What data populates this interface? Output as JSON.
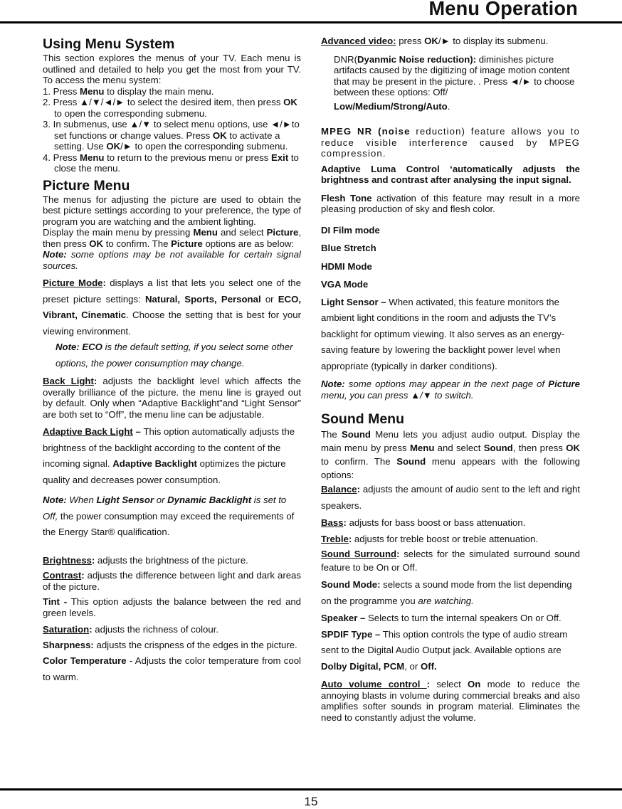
{
  "header": {
    "title": "Menu Operation"
  },
  "footer": {
    "page_number": "15"
  },
  "left_column": [
    {
      "type": "heading",
      "name": "using-menu-system-heading",
      "text": "Using Menu System"
    },
    {
      "type": "para",
      "name": "using-menu-intro",
      "cls": "",
      "runs": [
        {
          "t": "This section explores the menus of your TV. Each menu is outlined and detailed to help you get the most from your TV.  To access the menu system:"
        }
      ]
    },
    {
      "type": "para",
      "name": "step-1",
      "cls": "left",
      "runs": [
        {
          "t": "1. Press "
        },
        {
          "t": "Menu",
          "s": "b"
        },
        {
          "t": " to display the main menu."
        }
      ]
    },
    {
      "type": "para",
      "name": "step-2",
      "cls": "left ind2",
      "runs": [
        {
          "t": "2. Press ▲/▼/◄/► to select the desired item, then press "
        },
        {
          "t": "OK",
          "s": "b"
        },
        {
          "t": " to open the corresponding submenu."
        }
      ]
    },
    {
      "type": "para",
      "name": "step-3",
      "cls": "left ind2",
      "runs": [
        {
          "t": "3. In submenus, use ▲/▼ to select menu options, use ◄/►to set functions or change values. Press "
        },
        {
          "t": "OK",
          "s": "b"
        },
        {
          "t": " to activate a setting. Use "
        },
        {
          "t": "OK",
          "s": "b"
        },
        {
          "t": "/► to open the corresponding submenu."
        }
      ]
    },
    {
      "type": "para",
      "name": "step-4",
      "cls": "left ind2",
      "runs": [
        {
          "t": "4. Press "
        },
        {
          "t": "Menu",
          "s": "b"
        },
        {
          "t": " to return to the previous menu or press "
        },
        {
          "t": "Exit",
          "s": "b"
        },
        {
          "t": " to close the menu."
        }
      ]
    },
    {
      "type": "heading",
      "name": "picture-menu-heading",
      "cls": "gap4",
      "text": "Picture Menu"
    },
    {
      "type": "para",
      "name": "picture-menu-intro",
      "cls": "",
      "runs": [
        {
          "t": "The menus for adjusting the picture are used to obtain the best picture settings according to your preference, the type of program you are watching and the ambient lighting."
        }
      ]
    },
    {
      "type": "para",
      "name": "picture-menu-display",
      "cls": "",
      "runs": [
        {
          "t": "Display the main menu by pressing "
        },
        {
          "t": "Menu",
          "s": "b"
        },
        {
          "t": " and select "
        },
        {
          "t": "Picture",
          "s": "b"
        },
        {
          "t": ", then press "
        },
        {
          "t": "OK",
          "s": "b"
        },
        {
          "t": " to confirm. The "
        },
        {
          "t": "Picture",
          "s": "b"
        },
        {
          "t": " options are as below:"
        }
      ]
    },
    {
      "type": "para",
      "name": "picture-menu-note",
      "cls": "",
      "runs": [
        {
          "t": "Note:",
          "s": "bi"
        },
        {
          "t": " some options may be not available for certain signal sources.",
          "s": "i"
        }
      ]
    },
    {
      "type": "para",
      "name": "picture-mode",
      "cls": "tall gap6",
      "runs": [
        {
          "t": "Picture Mode",
          "s": "bu"
        },
        {
          "t": ":",
          "s": "b"
        },
        {
          "t": " displays a list that lets you select one of the preset picture settings:  "
        },
        {
          "t": "Natural, Sports, Personal",
          "s": "b"
        },
        {
          "t": " or "
        },
        {
          "t": "ECO, Vibrant, Cinematic",
          "s": "b"
        },
        {
          "t": ". Choose the setting that is best for your viewing environment."
        }
      ]
    },
    {
      "type": "para",
      "name": "picture-mode-note",
      "cls": "left tall ind",
      "runs": [
        {
          "t": "Note: ECO",
          "s": "bi"
        },
        {
          "t": " is the default setting, if you select some other options, the power consumption may change.",
          "s": "i"
        }
      ]
    },
    {
      "type": "para",
      "name": "back-light",
      "cls": "gap6",
      "runs": [
        {
          "t": "Back Light",
          "s": "bu"
        },
        {
          "t": ":",
          "s": "b"
        },
        {
          "t": " adjusts the backlight level which affects the overally brilliance of the picture. the menu line is grayed out by default. Only when “Adaptive Backlight”and “Light Sensor” are both set to “Off”, the menu line can be adjustable."
        }
      ]
    },
    {
      "type": "para",
      "name": "adaptive-back-light",
      "cls": "left tall gap6",
      "runs": [
        {
          "t": "Adaptive Back Light",
          "s": "bu"
        },
        {
          "t": " – ",
          "s": "b"
        },
        {
          "t": "This option automatically adjusts the brightness of the backlight according to the content of the incoming signal. "
        },
        {
          "t": "Adaptive Backlight",
          "s": "b"
        },
        {
          "t": " optimizes the picture quality and decreases power consumption."
        }
      ]
    },
    {
      "type": "para",
      "name": "adaptive-back-light-note",
      "cls": "left tall gap6",
      "runs": [
        {
          "t": "Note:",
          "s": "bi"
        },
        {
          "t": " When ",
          "s": "i"
        },
        {
          "t": "Light Sensor",
          "s": "bi"
        },
        {
          "t": " or ",
          "s": "i"
        },
        {
          "t": "Dynamic Backlight",
          "s": "bi"
        },
        {
          "t": " is set to Off,",
          "s": "i"
        },
        {
          "t": " the power consumption may exceed the requirements of the Energy Star® qualification."
        }
      ]
    },
    {
      "type": "para",
      "name": "brightness",
      "cls": "gap20",
      "runs": [
        {
          "t": "Brightness",
          "s": "bu"
        },
        {
          "t": ":",
          "s": "b"
        },
        {
          "t": " adjusts the brightness of the picture."
        }
      ]
    },
    {
      "type": "para",
      "name": "contrast",
      "cls": "gap6",
      "runs": [
        {
          "t": "Contrast",
          "s": "bu"
        },
        {
          "t": ":",
          "s": "b"
        },
        {
          "t": " adjusts the difference between light and dark areas of the picture."
        }
      ]
    },
    {
      "type": "para",
      "name": "tint",
      "cls": "gap6",
      "runs": [
        {
          "t": "Tint -",
          "s": "b"
        },
        {
          "t": " This option adjusts the balance between the red and green levels."
        }
      ]
    },
    {
      "type": "para",
      "name": "saturation",
      "cls": "gap8",
      "runs": [
        {
          "t": "Saturation",
          "s": "bu"
        },
        {
          "t": ":",
          "s": "b"
        },
        {
          "t": " adjusts the richness of colour."
        }
      ]
    },
    {
      "type": "para",
      "name": "sharpness",
      "cls": "gap6",
      "runs": [
        {
          "t": "Sharpness:",
          "s": "b"
        },
        {
          "t": " adjusts the crispness of the edges in the picture."
        }
      ]
    },
    {
      "type": "para",
      "name": "color-temperature",
      "cls": "tall gap4",
      "runs": [
        {
          "t": "Color Temperature",
          "s": "b"
        },
        {
          "t": " - Adjusts the color temperature from cool to warm."
        }
      ]
    }
  ],
  "right_column": [
    {
      "type": "para",
      "name": "advanced-video",
      "cls": "left",
      "runs": [
        {
          "t": "Advanced video:",
          "s": "bu"
        },
        {
          "t": " press "
        },
        {
          "t": "OK",
          "s": "b"
        },
        {
          "t": "/► to display its submenu."
        }
      ]
    },
    {
      "type": "para",
      "name": "dnr",
      "cls": "left ind gap10",
      "runs": [
        {
          "t": "DNR("
        },
        {
          "t": "Dyanmic Noise reduction):",
          "s": "b"
        },
        {
          "t": "  diminishes picture   artifacts caused by the digitizing of image motion content that may be present in the picture. . Press ◄/► to choose between these options: Off/"
        }
      ]
    },
    {
      "type": "para",
      "name": "dnr-options",
      "cls": "left ind gap4",
      "runs": [
        {
          "t": "Low/Medium/Strong/Auto",
          "s": "b"
        },
        {
          "t": "."
        }
      ]
    },
    {
      "type": "para",
      "name": "mpeg-nr",
      "cls": "spaced gap20",
      "runs": [
        {
          "t": "MPEG NR (noise",
          "s": "b"
        },
        {
          "t": " reduction) feature allows you to reduce visible interference caused by MPEG"
        },
        {
          "t": " compression."
        }
      ]
    },
    {
      "type": "para",
      "name": "adaptive-luma-control",
      "cls": "gap6",
      "runs": [
        {
          "t": "Adaptive Luma Control ‘automatically adjusts the brightness and contrast after analysing the input signal.",
          "s": "b"
        }
      ]
    },
    {
      "type": "para",
      "name": "flesh-tone",
      "cls": "gap10",
      "runs": [
        {
          "t": "Flesh Tone",
          "s": "b"
        },
        {
          "t": " activation of this feature may result in a more pleasing production of sky and flesh color."
        }
      ]
    },
    {
      "type": "para",
      "name": "di-film-mode",
      "cls": "left gap14",
      "runs": [
        {
          "t": "DI Film mode",
          "s": "b"
        }
      ]
    },
    {
      "type": "para",
      "name": "blue-stretch",
      "cls": "left gap10",
      "runs": [
        {
          "t": "Blue Stretch",
          "s": "b"
        }
      ]
    },
    {
      "type": "para",
      "name": "hdmi-mode",
      "cls": "left gap10",
      "runs": [
        {
          "t": "HDMI Mode",
          "s": "b"
        }
      ]
    },
    {
      "type": "para",
      "name": "vga-mode",
      "cls": "left gap10",
      "runs": [
        {
          "t": "VGA Mode",
          "s": "b"
        }
      ]
    },
    {
      "type": "para",
      "name": "light-sensor",
      "cls": "left tall gap6",
      "runs": [
        {
          "t": "Light Sensor –",
          "s": "b"
        },
        {
          "t": " When activated, this feature monitors the ambient light conditions in the room and adjusts the TV’s backlight for optimum viewing. It also serves as an energy-saving feature by lowering the backlight power level when appropriate (typically in darker conditions)."
        }
      ]
    },
    {
      "type": "para",
      "name": "picture-next-page-note",
      "cls": "gap6",
      "runs": [
        {
          "t": "Note:",
          "s": "bi"
        },
        {
          "t": " some options may appear in the next page of ",
          "s": "i"
        },
        {
          "t": "Picture",
          "s": "bi"
        },
        {
          "t": " menu, you can press ▲/▼ to switch.",
          "s": "i"
        }
      ]
    },
    {
      "type": "heading",
      "name": "sound-menu-heading",
      "cls": "gap14",
      "text": "Sound Menu"
    },
    {
      "type": "para",
      "name": "sound-menu-intro",
      "cls": "mid",
      "runs": [
        {
          "t": "The "
        },
        {
          "t": "Sound",
          "s": "b"
        },
        {
          "t": " Menu lets you adjust audio output. Display the main menu by press "
        },
        {
          "t": "Menu",
          "s": "b"
        },
        {
          "t": " and select "
        },
        {
          "t": "Sound",
          "s": "b"
        },
        {
          "t": ", then press "
        },
        {
          "t": "OK",
          "s": "b"
        },
        {
          "t": " to confirm. The "
        },
        {
          "t": "Sound",
          "s": "b"
        },
        {
          "t": " menu appears with the following options:"
        }
      ]
    },
    {
      "type": "para",
      "name": "balance",
      "cls": "tall",
      "runs": [
        {
          "t": "Balance",
          "s": "bu"
        },
        {
          "t": ":",
          "s": "b"
        },
        {
          "t": " adjusts the amount of audio sent to the left and right speakers."
        }
      ]
    },
    {
      "type": "para",
      "name": "bass",
      "cls": "tall gap2",
      "runs": [
        {
          "t": "Bass",
          "s": "bu"
        },
        {
          "t": ":",
          "s": "b"
        },
        {
          "t": " adjusts for bass boost or bass attenuation."
        }
      ]
    },
    {
      "type": "para",
      "name": "treble",
      "cls": "tall",
      "runs": [
        {
          "t": "Treble",
          "s": "bu"
        },
        {
          "t": ":",
          "s": "b"
        },
        {
          "t": " adjusts for treble boost or treble attenuation."
        }
      ]
    },
    {
      "type": "para",
      "name": "sound-surround",
      "cls": "mid",
      "runs": [
        {
          "t": "Sound Surround",
          "s": "bu"
        },
        {
          "t": ":",
          "s": "b"
        },
        {
          "t": " selects for the simulated surround sound feature to be On or Off."
        }
      ]
    },
    {
      "type": "para",
      "name": "sound-mode",
      "cls": "left tall gap4",
      "runs": [
        {
          "t": "Sound Mode:",
          "s": "b"
        },
        {
          "t": " selects a sound mode from the list depending on the programme you "
        },
        {
          "t": "are watching.",
          "s": "i"
        }
      ]
    },
    {
      "type": "para",
      "name": "speaker",
      "cls": "left tall gap2",
      "runs": [
        {
          "t": "Speaker –",
          "s": "b"
        },
        {
          "t": " Selects to turn the internal speakers On or Off."
        }
      ]
    },
    {
      "type": "para",
      "name": "spdif-type",
      "cls": "left tall",
      "runs": [
        {
          "t": "SPDIF Type –",
          "s": "b"
        },
        {
          "t": " This option controls the type of audio stream sent to the Digital Audio Output jack. Available options are "
        },
        {
          "t": "Dolby Digital, PCM",
          "s": "b"
        },
        {
          "t": ", or "
        },
        {
          "t": "Off.",
          "s": "b"
        }
      ]
    },
    {
      "type": "para",
      "name": "auto-volume-control",
      "cls": "gap6",
      "runs": [
        {
          "t": "Auto volume control ",
          "s": "bu"
        },
        {
          "t": ":",
          "s": "b"
        },
        {
          "t": " select "
        },
        {
          "t": "On",
          "s": "b"
        },
        {
          "t": " mode to reduce the annoying blasts in volume during commercial breaks and also amplifies softer sounds in program material. Eliminates the need to constantly adjust the volume."
        }
      ]
    }
  ]
}
